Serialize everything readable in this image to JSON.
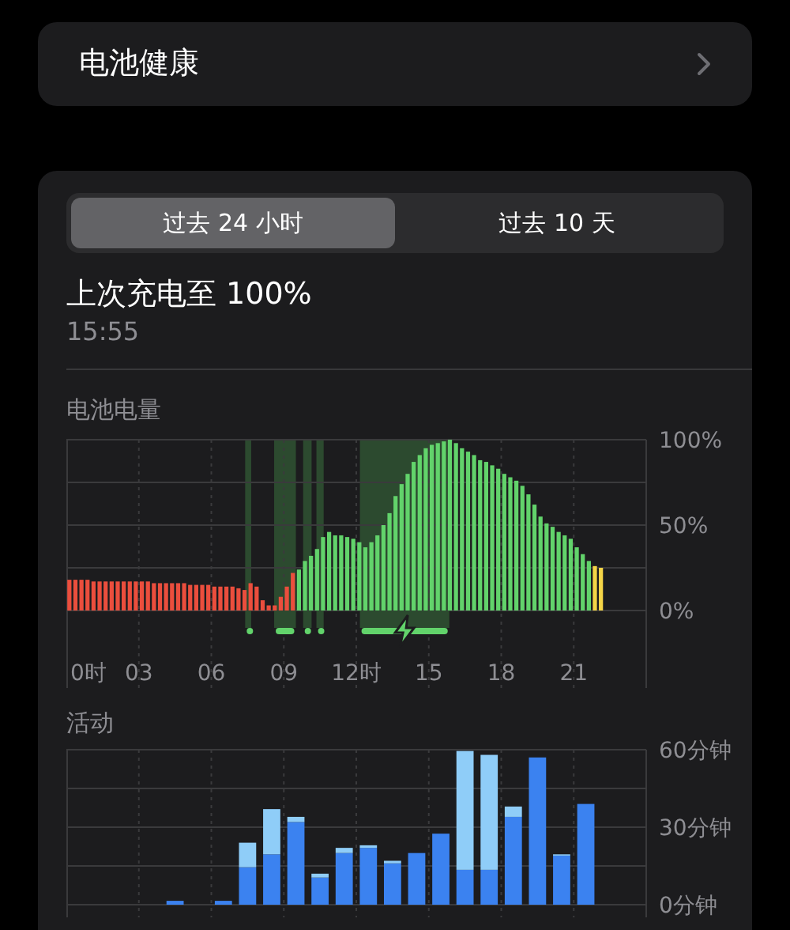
{
  "health_row": {
    "label": "电池健康"
  },
  "tabs": [
    {
      "label": "过去 24 小时",
      "selected": true
    },
    {
      "label": "过去 10 天",
      "selected": false
    }
  ],
  "last_charge": {
    "title": "上次充电至 100%",
    "time": "15:55"
  },
  "battery_level": {
    "label": "电池电量",
    "chart_data": {
      "type": "bar",
      "grid": true,
      "xlim": [
        0,
        24
      ],
      "x": [
        0.125,
        0.375,
        0.625,
        0.875,
        1.125,
        1.375,
        1.625,
        1.875,
        2.125,
        2.375,
        2.625,
        2.875,
        3.125,
        3.375,
        3.625,
        3.875,
        4.125,
        4.375,
        4.625,
        4.875,
        5.125,
        5.375,
        5.625,
        5.875,
        6.125,
        6.375,
        6.625,
        6.875,
        7.125,
        7.375,
        7.625,
        7.875,
        8.125,
        8.375,
        8.625,
        8.875,
        9.125,
        9.375,
        9.625,
        9.875,
        10.125,
        10.375,
        10.625,
        10.875,
        11.125,
        11.375,
        11.625,
        11.875,
        12.125,
        12.375,
        12.625,
        12.875,
        13.125,
        13.375,
        13.625,
        13.875,
        14.125,
        14.375,
        14.625,
        14.875,
        15.125,
        15.375,
        15.625,
        15.875,
        16.125,
        16.375,
        16.625,
        16.875,
        17.125,
        17.375,
        17.625,
        17.875,
        18.125,
        18.375,
        18.625,
        18.875,
        19.125,
        19.375,
        19.625,
        19.875,
        20.125,
        20.375,
        20.625,
        20.875,
        21.125,
        21.375,
        21.625,
        21.875,
        22.125
      ],
      "xticks": [
        {
          "value": 0,
          "label": "0时"
        },
        {
          "value": 3,
          "label": "03"
        },
        {
          "value": 6,
          "label": "06"
        },
        {
          "value": 9,
          "label": "09"
        },
        {
          "value": 12,
          "label": "12时"
        },
        {
          "value": 15,
          "label": "15"
        },
        {
          "value": 18,
          "label": "18"
        },
        {
          "value": 21,
          "label": "21"
        }
      ],
      "ylim": [
        0,
        100
      ],
      "yticks": [
        {
          "value": 0,
          "label": "0%"
        },
        {
          "value": 50,
          "label": "50%"
        },
        {
          "value": 100,
          "label": "100%"
        }
      ],
      "series": [
        {
          "color": "#eb4e3d",
          "values": [
            18,
            18,
            18,
            18,
            17,
            17,
            17,
            17,
            17,
            17,
            17,
            17,
            17,
            17,
            16,
            16,
            16,
            16,
            16,
            16,
            15,
            15,
            15,
            15,
            14,
            14,
            14,
            14,
            13,
            12,
            16,
            14,
            6,
            3,
            3,
            8,
            14,
            22,
            null,
            null,
            null,
            null,
            null,
            null,
            null,
            null,
            null,
            null,
            null,
            null,
            null,
            null,
            null,
            null,
            null,
            null,
            null,
            null,
            null,
            null,
            null,
            null,
            null,
            null,
            null,
            null,
            null,
            null,
            null,
            null,
            null,
            null,
            null,
            null,
            null,
            null,
            null,
            null,
            null,
            null,
            null,
            null,
            null,
            null,
            null,
            null,
            null,
            null,
            null
          ]
        },
        {
          "color": "#62d36b",
          "values": [
            null,
            null,
            null,
            null,
            null,
            null,
            null,
            null,
            null,
            null,
            null,
            null,
            null,
            null,
            null,
            null,
            null,
            null,
            null,
            null,
            null,
            null,
            null,
            null,
            null,
            null,
            null,
            null,
            null,
            null,
            null,
            null,
            null,
            null,
            null,
            null,
            null,
            null,
            24,
            29,
            32,
            36,
            43,
            46,
            44,
            44,
            43,
            42,
            40,
            37,
            40,
            44,
            50,
            57,
            67,
            74,
            80,
            87,
            91,
            95,
            97,
            98,
            99,
            100,
            98,
            95,
            93,
            91,
            88,
            87,
            85,
            83,
            80,
            78,
            76,
            73,
            68,
            62,
            55,
            51,
            49,
            46,
            44,
            42,
            37,
            33,
            29,
            null,
            null
          ]
        },
        {
          "color": "#f5d547",
          "values": [
            null,
            null,
            null,
            null,
            null,
            null,
            null,
            null,
            null,
            null,
            null,
            null,
            null,
            null,
            null,
            null,
            null,
            null,
            null,
            null,
            null,
            null,
            null,
            null,
            null,
            null,
            null,
            null,
            null,
            null,
            null,
            null,
            null,
            null,
            null,
            null,
            null,
            null,
            null,
            null,
            null,
            null,
            null,
            null,
            null,
            null,
            null,
            null,
            null,
            null,
            null,
            null,
            null,
            null,
            null,
            null,
            null,
            null,
            null,
            null,
            null,
            null,
            null,
            null,
            null,
            null,
            null,
            null,
            null,
            null,
            null,
            null,
            null,
            null,
            null,
            null,
            null,
            null,
            null,
            null,
            null,
            null,
            null,
            null,
            null,
            null,
            null,
            26,
            25
          ]
        }
      ],
      "bands": [
        {
          "axis": "x",
          "from": 7.4,
          "to": 7.65
        },
        {
          "axis": "x",
          "from": 8.6,
          "to": 9.5
        },
        {
          "axis": "x",
          "from": 9.8,
          "to": 10.15
        },
        {
          "axis": "x",
          "from": 10.35,
          "to": 10.65
        },
        {
          "axis": "x",
          "from": 12.15,
          "to": 15.85
        }
      ]
    }
  },
  "activity": {
    "label": "活动",
    "chart_data": {
      "type": "bar",
      "stacked": true,
      "grid": true,
      "x": [
        0.5,
        1.5,
        2.5,
        3.5,
        4.5,
        5.5,
        6.5,
        7.5,
        8.5,
        9.5,
        10.5,
        11.5,
        12.5,
        13.5,
        14.5,
        15.5,
        16.5,
        17.5,
        18.5,
        19.5,
        20.5,
        21.5,
        22.5,
        23.5
      ],
      "xlim": [
        0,
        24
      ],
      "ylim": [
        0,
        60
      ],
      "yticks": [
        {
          "value": 0,
          "label": "0分钟"
        },
        {
          "value": 30,
          "label": "30分钟"
        },
        {
          "value": 60,
          "label": "60分钟"
        }
      ],
      "series": [
        {
          "color": "#3b82f0",
          "values": [
            0,
            0,
            0,
            0,
            1.5,
            0,
            1.5,
            14.5,
            19.5,
            32,
            10.5,
            20,
            22,
            16,
            20,
            27.5,
            13.5,
            13.5,
            34,
            57,
            19,
            39,
            0,
            0
          ]
        },
        {
          "color": "#8fcdf8",
          "values": [
            0,
            0,
            0,
            0,
            0,
            0,
            0,
            9.5,
            17.5,
            2,
            1.5,
            2,
            1,
            1,
            0,
            0,
            46,
            44.5,
            4,
            0,
            0.5,
            0,
            0,
            0
          ]
        }
      ]
    }
  }
}
